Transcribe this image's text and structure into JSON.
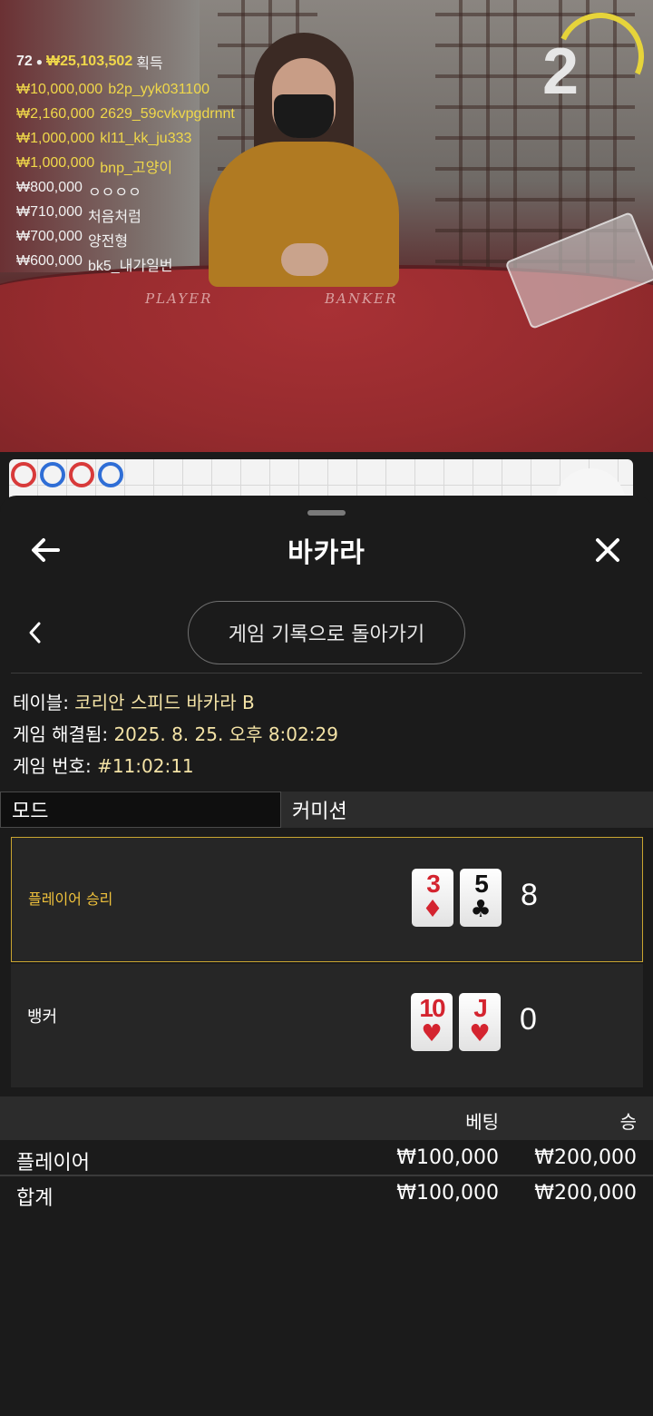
{
  "stream": {
    "countdown": "2",
    "table_labels": {
      "player": "PLAYER",
      "banker": "BANKER"
    },
    "winners_header": {
      "count": "72",
      "total": "₩25,103,502",
      "word": "획득"
    },
    "winners": [
      {
        "amount": "₩10,000,000",
        "name": "b2p_yyk031100",
        "tone": "gold"
      },
      {
        "amount": "₩2,160,000",
        "name": "2629_59cvkvpgdrnnt",
        "tone": "gold"
      },
      {
        "amount": "₩1,000,000",
        "name": "kl11_kk_ju333",
        "tone": "gold"
      },
      {
        "amount": "₩1,000,000",
        "name": "bnp_고양이",
        "tone": "gold"
      },
      {
        "amount": "₩800,000",
        "name": "ㅇㅇㅇㅇ",
        "tone": "white"
      },
      {
        "amount": "₩710,000",
        "name": "처음처럼",
        "tone": "white"
      },
      {
        "amount": "₩700,000",
        "name": "양전형",
        "tone": "white"
      },
      {
        "amount": "₩600,000",
        "name": "bk5_내가일번",
        "tone": "white"
      }
    ]
  },
  "header": {
    "title": "바카라",
    "back_icon": "arrow-left-icon",
    "close_icon": "close-icon"
  },
  "nav": {
    "back_to_history": "게임 기록으로 돌아가기",
    "prev_icon": "chevron-left-icon"
  },
  "info": {
    "table_label": "테이블: ",
    "table_value": "코리안 스피드 바카라 B",
    "resolved_label": "게임 해결됨: ",
    "resolved_value": "2025. 8. 25. 오후 8:02:29",
    "number_label": "게임 번호: ",
    "number_value": "#11:02:11"
  },
  "tabs": {
    "mode": "모드",
    "commission": "커미션"
  },
  "results": {
    "player": {
      "label": "플레이어 승리",
      "cards": [
        {
          "rank": "3",
          "suit": "♦",
          "color": "red"
        },
        {
          "rank": "5",
          "suit": "♣",
          "color": "black"
        }
      ],
      "score": "8"
    },
    "banker": {
      "label": "뱅커",
      "cards": [
        {
          "rank": "10",
          "suit": "♥",
          "color": "red"
        },
        {
          "rank": "J",
          "suit": "♥",
          "color": "red"
        }
      ],
      "score": "0"
    }
  },
  "bets": {
    "headers": {
      "bet": "베팅",
      "win": "승"
    },
    "rows": [
      {
        "name": "플레이어",
        "bet": "₩100,000",
        "win": "₩200,000"
      },
      {
        "name": "합계",
        "bet": "₩100,000",
        "win": "₩200,000"
      }
    ]
  },
  "colors": {
    "accent_gold": "#c9a530",
    "value_cream": "#f4e3a6",
    "card_red": "#d4242f"
  }
}
